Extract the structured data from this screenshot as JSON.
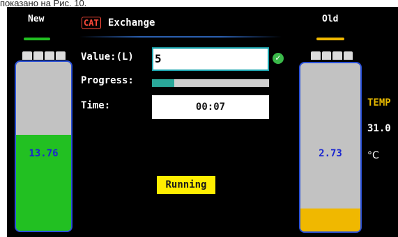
{
  "caption": "показано на Рис. 10.",
  "tank_new": {
    "title": "New",
    "value": "13.76",
    "fill_fraction": 0.57,
    "fill_color": "#22c022"
  },
  "tank_old": {
    "title": "Old",
    "value": "2.73",
    "fill_fraction": 0.135,
    "fill_color": "#f0b800"
  },
  "header": {
    "badge": "CAT",
    "title": "Exchange"
  },
  "form": {
    "value_label": "Value:(L)",
    "value_input": "5",
    "progress_label": "Progress:",
    "progress_fraction": 0.19,
    "time_label": "Time:",
    "time_value": "00:07"
  },
  "status": "Running",
  "temp": {
    "label": "TEMP",
    "value": "31.0",
    "unit": "°C"
  },
  "colors": {
    "accent_new": "#22c022",
    "accent_old": "#f0b800",
    "tank_border": "#2a50d8",
    "progress": "#2aa89a"
  }
}
